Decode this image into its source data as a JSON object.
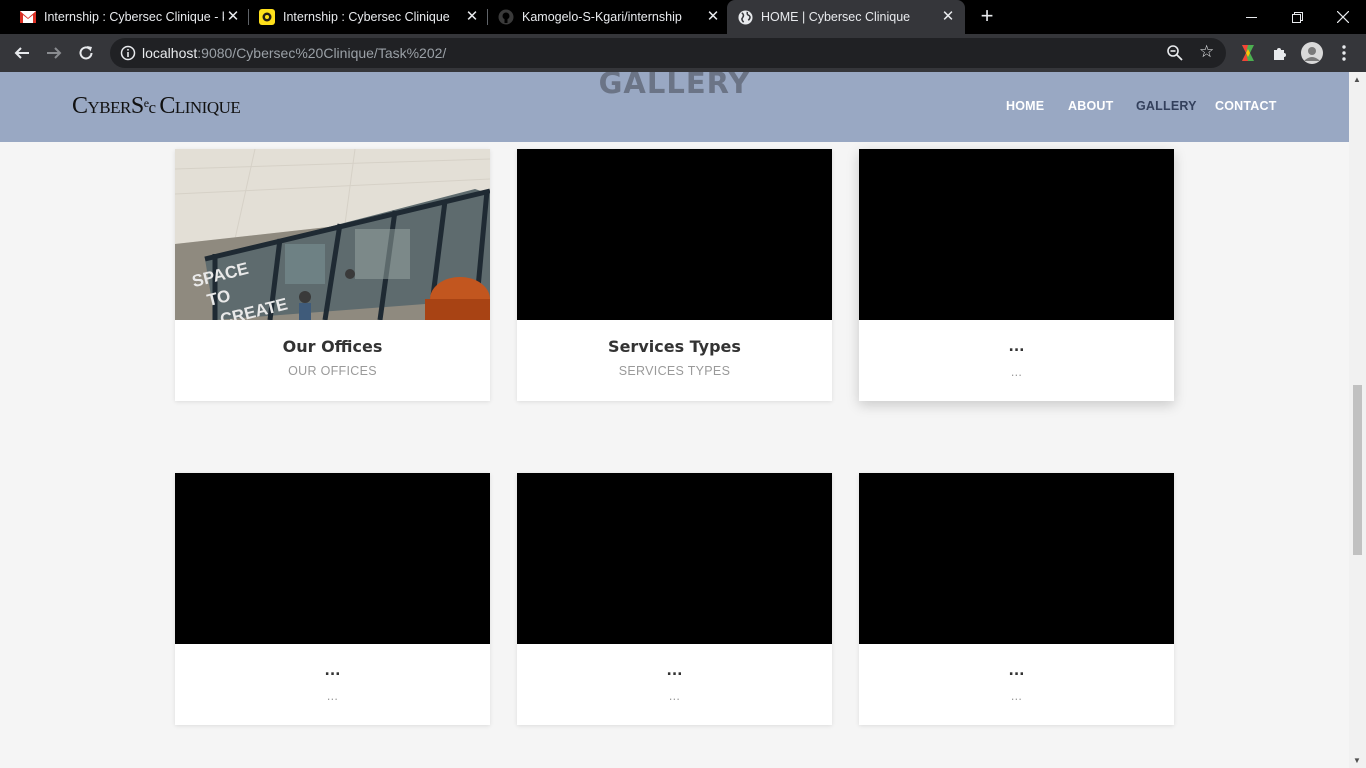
{
  "browser": {
    "tabs": [
      {
        "title": "Internship : Cybersec Clinique - k",
        "icon": "gmail-icon"
      },
      {
        "title": "Internship : Cybersec Clinique",
        "icon": "mailchimp-icon"
      },
      {
        "title": "Kamogelo-S-Kgari/internship",
        "icon": "github-icon"
      },
      {
        "title": "HOME | Cybersec Clinique",
        "icon": "globe-icon"
      }
    ],
    "url_host": "localhost",
    "url_path": ":9080/Cybersec%20Clinique/Task%202/"
  },
  "site": {
    "section_title": "GALLERY",
    "logo_parts": [
      "C",
      "YBER",
      "S",
      "e",
      "c ",
      "C",
      "LINIQUE"
    ],
    "nav": {
      "home": "HOME",
      "about": "ABOUT",
      "gallery": "GALLERY",
      "contact": "CONTACT"
    },
    "accent_color": "#99a8c3",
    "active_nav_color": "#33405c"
  },
  "gallery": {
    "cards": [
      {
        "title": "Our Offices",
        "subtitle": "OUR OFFICES",
        "image": "office-photo"
      },
      {
        "title": "Services Types",
        "subtitle": "SERVICES TYPES",
        "image": "black"
      },
      {
        "title": "...",
        "subtitle": "...",
        "image": "black"
      },
      {
        "title": "...",
        "subtitle": "...",
        "image": "black"
      },
      {
        "title": "...",
        "subtitle": "...",
        "image": "black"
      },
      {
        "title": "...",
        "subtitle": "...",
        "image": "black"
      }
    ]
  }
}
